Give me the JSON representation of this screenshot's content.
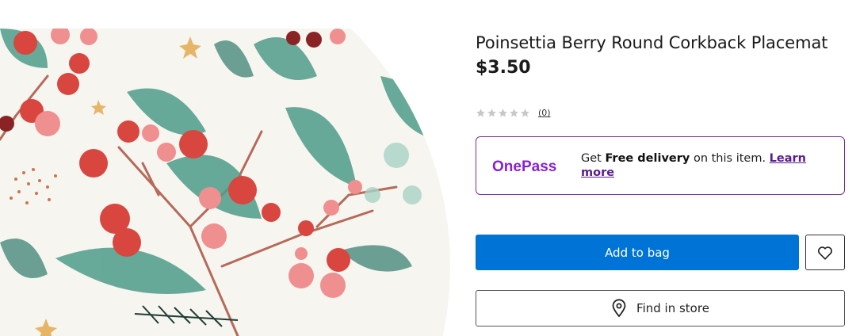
{
  "product": {
    "title": "Poinsettia Berry Round Corkback Placemat",
    "price": "$3.50",
    "rating": {
      "stars": 0,
      "max_stars": 5,
      "review_count": "(0)"
    }
  },
  "onepass": {
    "logo_text": "OnePass",
    "text_prefix": "Get ",
    "text_bold": "Free delivery",
    "text_suffix": " on this item. ",
    "learn_more": "Learn more"
  },
  "actions": {
    "add_to_bag": "Add to bag",
    "find_in_store": "Find in store"
  },
  "icons": {
    "wishlist": "heart-outline-icon",
    "store": "location-pin-icon",
    "star": "star-icon"
  },
  "colors": {
    "primary_button": "#0073d6",
    "onepass_purple": "#7a2c9a",
    "star_empty": "#c8c8c8"
  }
}
